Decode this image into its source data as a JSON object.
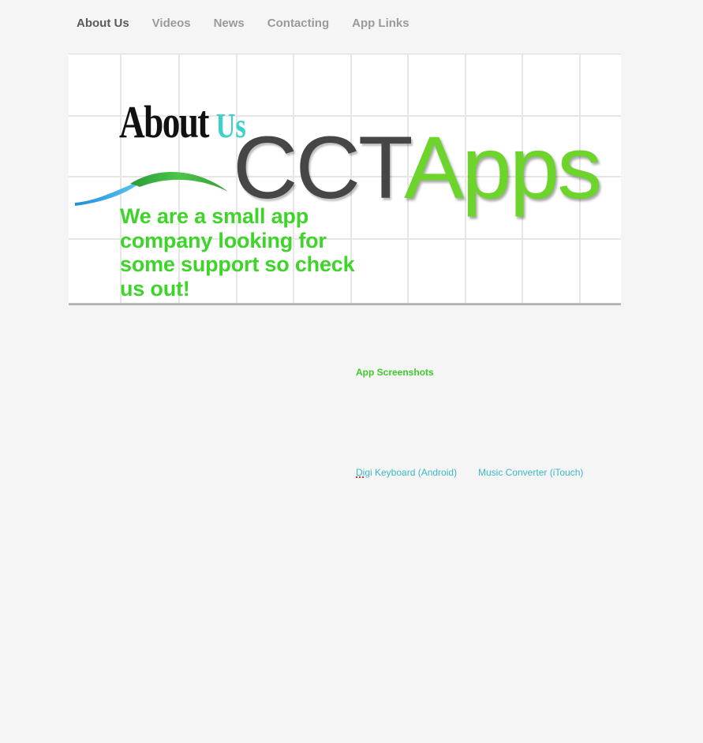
{
  "nav": {
    "items": [
      {
        "label": "About Us",
        "active": true
      },
      {
        "label": "Videos",
        "active": false
      },
      {
        "label": "News",
        "active": false
      },
      {
        "label": "Contacting",
        "active": false
      },
      {
        "label": "App Links",
        "active": false
      }
    ]
  },
  "banner": {
    "heading_about": "About",
    "heading_us": "Us",
    "logo_part1": "CCT",
    "logo_part2": "Apps",
    "tagline": "We are a small app company looking for some support so check us out!"
  },
  "content": {
    "screenshots_title": "App Screenshots",
    "links": [
      {
        "label_prefix": "Digi",
        "label_rest": " Keyboard (Android)"
      },
      {
        "label": "Music Converter (iTouch)"
      }
    ]
  },
  "colors": {
    "background": "#f5f5f5",
    "nav_active": "#5a5a5a",
    "nav_inactive": "#9a9a9a",
    "accent_green": "#3ed42a",
    "logo_dark": "#464646",
    "accent_teal": "#3ed1c9",
    "link": "#3ab8c8"
  }
}
